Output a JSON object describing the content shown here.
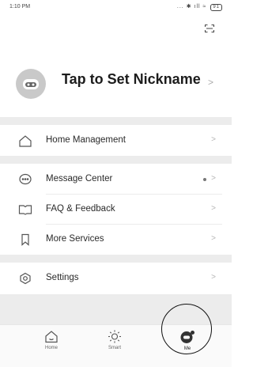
{
  "status_bar": {
    "time": "1:10 PM",
    "icons": "... ✱ ıll ≈",
    "battery": "91"
  },
  "profile": {
    "nickname_prompt": "Tap to Set Nickname",
    "chevron": ">"
  },
  "menu": {
    "home_management": {
      "label": "Home Management",
      "icon": "house-icon"
    },
    "message_center": {
      "label": "Message Center",
      "icon": "chat-bubble-icon",
      "unread_dot": true
    },
    "faq_feedback": {
      "label": "FAQ & Feedback",
      "icon": "book-icon"
    },
    "more_services": {
      "label": "More Services",
      "icon": "bookmark-icon"
    },
    "settings": {
      "label": "Settings",
      "icon": "settings-icon"
    },
    "chevron": ">"
  },
  "tabbar": {
    "home": {
      "label": "Home",
      "icon": "house-outline-icon"
    },
    "smart": {
      "label": "Smart",
      "icon": "sun-icon"
    },
    "me": {
      "label": "Me",
      "icon": "user-avatar-icon",
      "selected": true
    }
  },
  "colors": {
    "background": "#ffffff",
    "section_gap": "#ececec",
    "chevron": "#b5b5b5",
    "text": "#222222",
    "selected_ring": "#111111"
  }
}
